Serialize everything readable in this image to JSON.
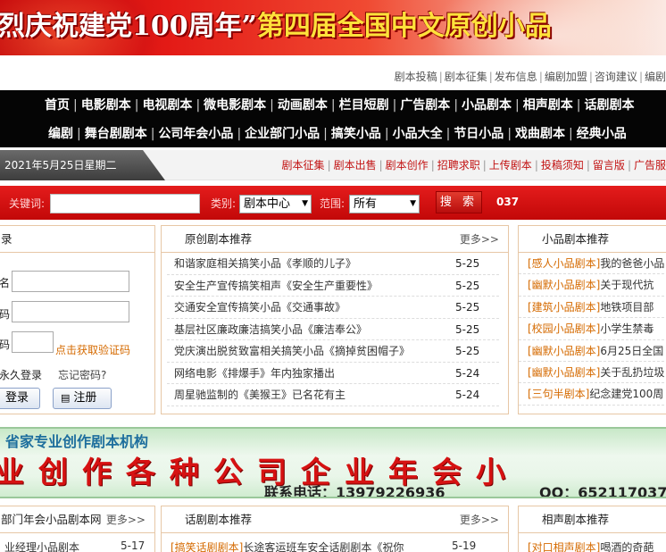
{
  "banner": {
    "part1": "烈庆祝建党100周年”",
    "part2": "第四届全国中文原创小品"
  },
  "info_links": [
    "剧本投稿",
    "剧本征集",
    "发布信息",
    "编剧加盟",
    "咨询建议",
    "编剧"
  ],
  "nav_row1": [
    "首页",
    "电影剧本",
    "电视剧本",
    "微电影剧本",
    "动画剧本",
    "栏目短剧",
    "广告剧本",
    "小品剧本",
    "相声剧本",
    "话剧剧本"
  ],
  "nav_row2": [
    "编剧",
    "舞台剧剧本",
    "公司年会小品",
    "企业部门小品",
    "搞笑小品",
    "小品大全",
    "节日小品",
    "戏曲剧本",
    "经典小品"
  ],
  "date": "2021年5月25日星期二",
  "sub_links": [
    "剧本征集",
    "剧本出售",
    "剧本创作",
    "招聘求职",
    "上传剧本",
    "投稿须知",
    "留言版",
    "广告服"
  ],
  "search": {
    "keyword_label": "关键词:",
    "type_label": "类别:",
    "type_value": "剧本中心",
    "range_label": "范围:",
    "range_value": "所有",
    "button": "搜 索",
    "count": "037"
  },
  "login": {
    "title": "录",
    "user_label": "名",
    "pass_label": "码",
    "code_label": "码",
    "get_code": "点击获取验证码",
    "remember": "永久登录",
    "forgot": "忘记密码?",
    "login_btn": "登录",
    "register_btn": "注册"
  },
  "recommend": {
    "title": "原创剧本推荐",
    "more": "更多>>",
    "items": [
      {
        "title": "和谐家庭相关搞笑小品《孝顺的儿子》",
        "date": "5-25"
      },
      {
        "title": "安全生产宣传搞笑相声《安全生产重要性》",
        "date": "5-25"
      },
      {
        "title": "交通安全宣传搞笑小品《交通事故》",
        "date": "5-25"
      },
      {
        "title": "基层社区廉政廉洁搞笑小品《廉洁奉公》",
        "date": "5-25"
      },
      {
        "title": "党庆演出脱贫致富相关搞笑小品《摘掉贫困帽子》",
        "date": "5-25"
      },
      {
        "title": "网络电影《排爆手》年内独家播出",
        "date": "5-24"
      },
      {
        "title": "周星驰监制的《美猴王》已名花有主",
        "date": "5-24"
      }
    ]
  },
  "xiaopin": {
    "title": "小品剧本推荐",
    "items": [
      {
        "cat": "[感人小品剧本]",
        "text": "我的爸爸小品"
      },
      {
        "cat": "[幽默小品剧本]",
        "text": "关于现代抗"
      },
      {
        "cat": "[建筑小品剧本]",
        "text": "地铁项目部"
      },
      {
        "cat": "[校园小品剧本]",
        "text": "小学生禁毒"
      },
      {
        "cat": "[幽默小品剧本]",
        "text": "6月25日全国"
      },
      {
        "cat": "[幽默小品剧本]",
        "text": "关于乱扔垃圾"
      },
      {
        "cat": "[三句半剧本]",
        "text": "纪念建党100周"
      }
    ]
  },
  "ad": {
    "title": "省家专业创作剧本机构",
    "slogan": "业创作各种公司企业年会小",
    "phone": "联系电话：13979226936",
    "qq": "QQ：652117037"
  },
  "company": {
    "title": "部门年会小品剧本网",
    "more": "更多>>",
    "row": "业经理小品剧本",
    "row_date": "5-17"
  },
  "drama": {
    "title": "话剧剧本推荐",
    "more": "更多>>",
    "row_cat": "[搞笑话剧剧本]",
    "row_text": "长途客运班车安全话剧剧本《祝你",
    "row_date": "5-19"
  },
  "crosstalk": {
    "title": "相声剧本推荐",
    "row_cat": "[对口相声剧本]",
    "row_text": "喝酒的奇葩"
  }
}
